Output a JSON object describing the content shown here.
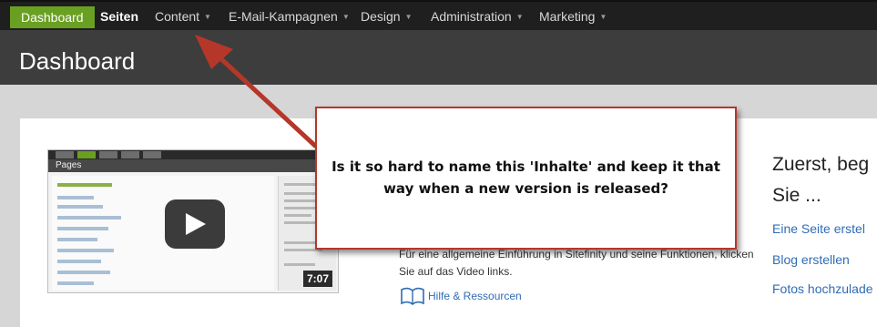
{
  "nav": {
    "items": [
      {
        "label": "Dashboard"
      },
      {
        "label": "Seiten"
      },
      {
        "label": "Content"
      },
      {
        "label": "E-Mail-Kampagnen"
      },
      {
        "label": "Design"
      },
      {
        "label": "Administration"
      },
      {
        "label": "Marketing"
      }
    ],
    "caret": "▼"
  },
  "header": {
    "title": "Dashboard"
  },
  "video": {
    "mini_title": "Pages",
    "duration": "7:07"
  },
  "intro": {
    "heading_line1": "Zuerst, beg",
    "heading_line2": "Sie ...",
    "links": [
      "Eine Seite erstel",
      "Blog erstellen",
      "Fotos hochzulade"
    ],
    "description": "Für eine allgemeine Einführung in Sitefinity und seine Funktionen, klicken Sie auf das Video links.",
    "resources_label": "Hilfe & Ressourcen"
  },
  "annotation": {
    "text": "Is it so hard to name this 'Inhalte' and keep it that way when a new version is released?"
  },
  "colors": {
    "active_nav": "#6aa022",
    "link": "#2f6cb5",
    "annotation_red": "#b5372a"
  }
}
